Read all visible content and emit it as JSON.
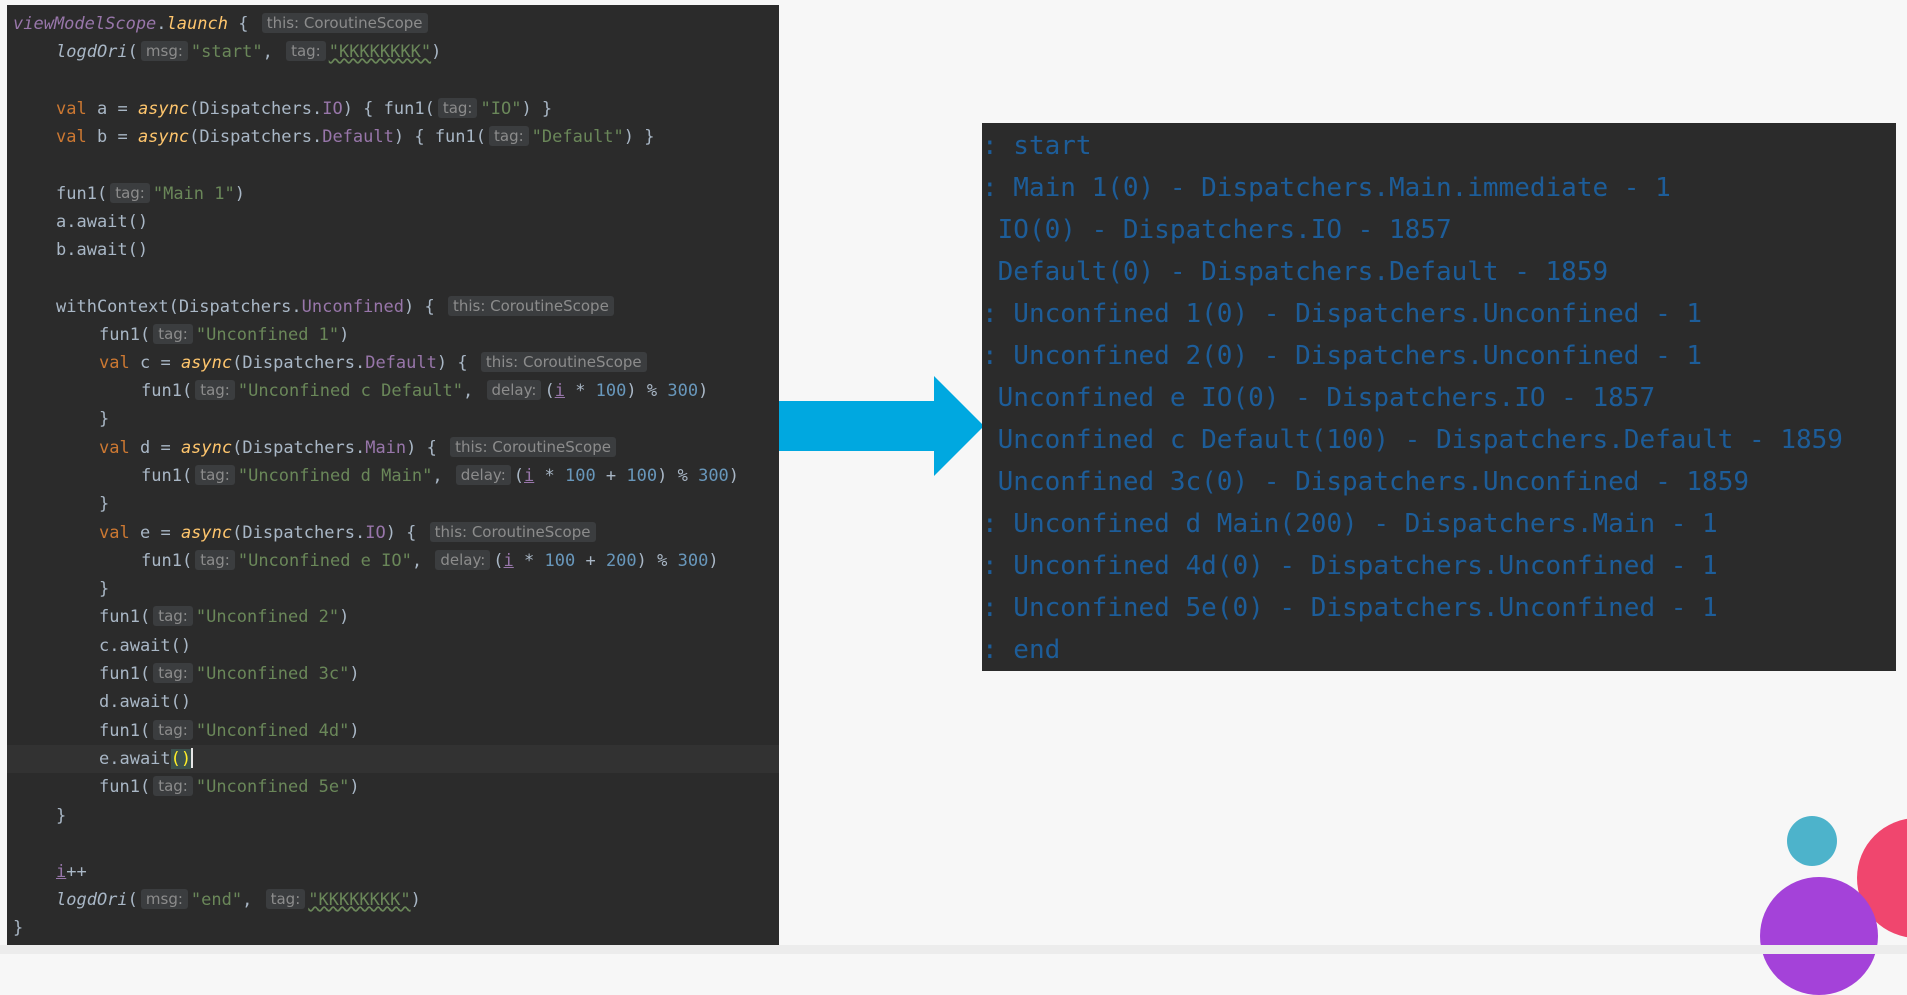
{
  "code": {
    "scope_hint": "this: CoroutineScope",
    "msg_hint": "msg:",
    "tag_hint": "tag:",
    "delay_hint": "delay:",
    "tag_value": "\"KKKKKKKK\"",
    "lines": {
      "l1_scope": "viewModelScope",
      "l1_launch": "launch",
      "l2_fn": "logdOri",
      "l2_msg": "\"start\"",
      "l4_val": "val",
      "l4_name": "a",
      "l4_async": "async",
      "l4_dispatcher": "Dispatchers.",
      "l4_io": "IO",
      "l4_fun": "fun1(",
      "l4_tag": "\"IO\"",
      "l5_name": "b",
      "l5_default": "Default",
      "l5_tag": "\"Default\"",
      "l7_tag": "\"Main 1\"",
      "l8_text": "a.await()",
      "l9_text": "b.await()",
      "l11_with": "withContext(Dispatchers.",
      "l11_unconfined": "Unconfined",
      "l12_tag": "\"Unconfined 1\"",
      "l13_name": "c",
      "l14_tag": "\"Unconfined c Default\"",
      "l16_name": "d",
      "l16_main": "Main",
      "l17_tag": "\"Unconfined d Main\"",
      "l19_name": "e",
      "l20_tag": "\"Unconfined e IO\"",
      "l22_tag": "\"Unconfined 2\"",
      "l23_text": "c.await()",
      "l24_tag": "\"Unconfined 3c\"",
      "l25_text": "d.await()",
      "l26_tag": "\"Unconfined 4d\"",
      "l27_text": "e.await",
      "l28_tag": "\"Unconfined 5e\"",
      "l31_var": "i",
      "l31_op": "++",
      "l32_msg": "\"end\"",
      "num_100": "100",
      "num_200": "200",
      "num_300": "300"
    }
  },
  "log": {
    "lines": [
      ": start",
      ": Main 1(0) - Dispatchers.Main.immediate - 1",
      " IO(0) - Dispatchers.IO - 1857",
      " Default(0) - Dispatchers.Default - 1859",
      ": Unconfined 1(0) - Dispatchers.Unconfined - 1",
      ": Unconfined 2(0) - Dispatchers.Unconfined - 1",
      " Unconfined e IO(0) - Dispatchers.IO - 1857",
      " Unconfined c Default(100) - Dispatchers.Default - 1859",
      " Unconfined 3c(0) - Dispatchers.Unconfined - 1859",
      ": Unconfined d Main(200) - Dispatchers.Main - 1",
      ": Unconfined 4d(0) - Dispatchers.Unconfined - 1",
      ": Unconfined 5e(0) - Dispatchers.Unconfined - 1",
      ": end"
    ]
  },
  "colors": {
    "editor_bg": "#2b2b2b",
    "keyword": "#cc7832",
    "string": "#6a8759",
    "number": "#6897bb",
    "function_italic": "#ffc66d",
    "purple": "#9876aa",
    "log_text": "#1d5d99",
    "arrow": "#00a8e0",
    "circle_teal": "#4db3cb",
    "circle_pink": "#f0466e",
    "circle_purple": "#a442d9"
  }
}
